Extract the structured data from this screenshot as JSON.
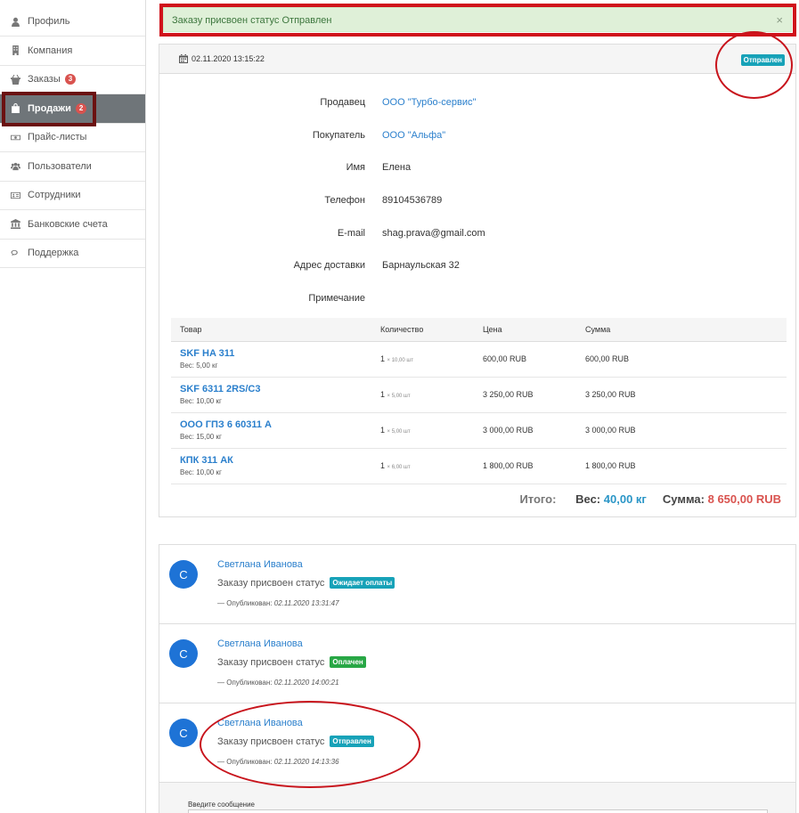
{
  "sidebar": {
    "items": [
      {
        "label": "Профиль",
        "icon": "user-icon"
      },
      {
        "label": "Компания",
        "icon": "building-icon"
      },
      {
        "label": "Заказы",
        "icon": "basket-icon",
        "badge": "3"
      },
      {
        "label": "Продажи",
        "icon": "shopping-bag-icon",
        "badge": "2"
      },
      {
        "label": "Прайс-листы",
        "icon": "money-icon"
      },
      {
        "label": "Пользователи",
        "icon": "users-icon"
      },
      {
        "label": "Сотрудники",
        "icon": "id-card-icon"
      },
      {
        "label": "Банковские счета",
        "icon": "bank-icon"
      },
      {
        "label": "Поддержка",
        "icon": "comments-icon"
      }
    ]
  },
  "alert": {
    "text": "Заказу присвоен статус Отправлен",
    "close": "×"
  },
  "order": {
    "datetime": "02.11.2020 13:15:22",
    "status": "Отправлен",
    "fields": {
      "seller_label": "Продавец",
      "seller": "ООО \"Турбо-сервис\"",
      "buyer_label": "Покупатель",
      "buyer": "ООО \"Альфа\"",
      "name_label": "Имя",
      "name": "Елена",
      "phone_label": "Телефон",
      "phone": "89104536789",
      "email_label": "E-mail",
      "email": "shag.prava@gmail.com",
      "address_label": "Адрес доставки",
      "address": "Барнаульская 32",
      "note_label": "Примечание",
      "note": ""
    },
    "table": {
      "headers": [
        "Товар",
        "Количество",
        "Цена",
        "Сумма"
      ],
      "rows": [
        {
          "name": "SKF HA 311",
          "weight": "Вес: 5,00 кг",
          "qty": "1",
          "qty_unit": "× 10,00 шт",
          "price": "600,00 RUB",
          "sum": "600,00 RUB"
        },
        {
          "name": "SKF 6311 2RS/C3",
          "weight": "Вес: 10,00 кг",
          "qty": "1",
          "qty_unit": "× 5,00 шт",
          "price": "3 250,00 RUB",
          "sum": "3 250,00 RUB"
        },
        {
          "name": "ООО ГПЗ 6 60311 А",
          "weight": "Вес: 15,00 кг",
          "qty": "1",
          "qty_unit": "× 5,00 шт",
          "price": "3 000,00 RUB",
          "sum": "3 000,00 RUB"
        },
        {
          "name": "КПК 311 АК",
          "weight": "Вес: 10,00 кг",
          "qty": "1",
          "qty_unit": "× 6,00 шт",
          "price": "1 800,00 RUB",
          "sum": "1 800,00 RUB"
        }
      ]
    },
    "totals": {
      "label": "Итого:",
      "weight_label": "Вес:",
      "weight": "40,00 кг",
      "sum_label": "Сумма:",
      "sum": "8 650,00 RUB"
    }
  },
  "comments": {
    "items": [
      {
        "avatar": "С",
        "author": "Светлана Иванова",
        "text": "Заказу присвоен статус",
        "status": "Ожидает оплаты",
        "status_color": "#17a2b8",
        "published_label": "— Опубликован:",
        "published": "02.11.2020 13:31:47"
      },
      {
        "avatar": "С",
        "author": "Светлана Иванова",
        "text": "Заказу присвоен статус",
        "status": "Оплачен",
        "status_color": "#28a745",
        "published_label": "— Опубликован:",
        "published": "02.11.2020 14:00:21"
      },
      {
        "avatar": "С",
        "author": "Светлана Иванова",
        "text": "Заказу присвоен статус",
        "status": "Отправлен",
        "status_color": "#17a2b8",
        "published_label": "— Опубликован:",
        "published": "02.11.2020 14:13:36"
      }
    ],
    "message_label": "Введите сообщение"
  }
}
